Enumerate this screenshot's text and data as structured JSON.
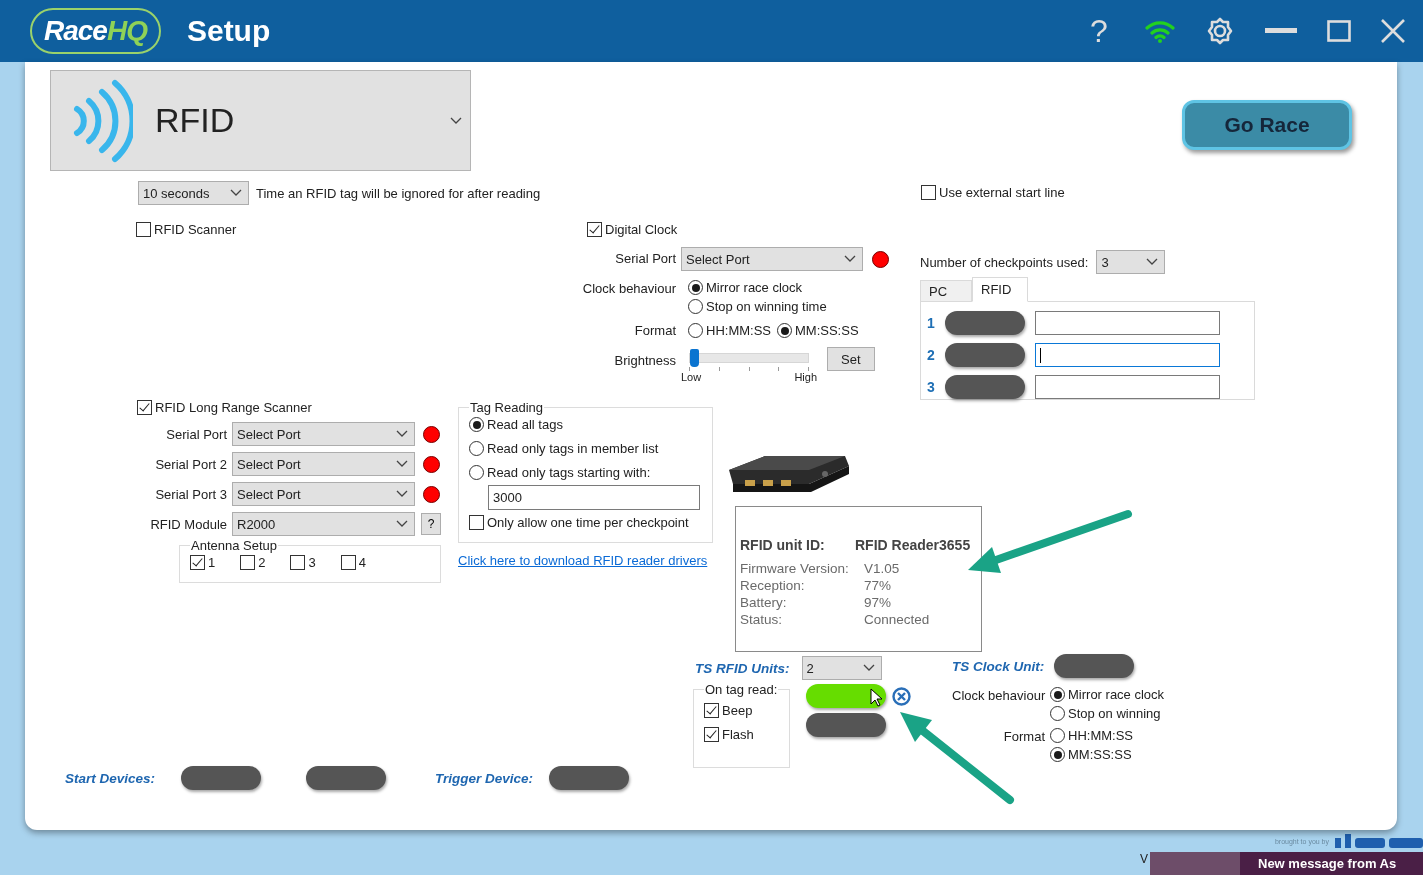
{
  "header": {
    "logo": [
      "Race",
      "HQ"
    ],
    "title": "Setup",
    "help": "?"
  },
  "module_select": {
    "value": "RFID"
  },
  "go_race": "Go Race",
  "ignore_time": {
    "value": "10 seconds",
    "label": "Time an RFID tag will be ignored for after reading"
  },
  "rfid_scanner": {
    "label": "RFID Scanner",
    "checked": false
  },
  "digital_clock": {
    "label": "Digital Clock",
    "checked": true,
    "serial_port": {
      "label": "Serial Port",
      "value": "Select Port",
      "color": "#ff0000"
    },
    "clock_behaviour": {
      "label": "Clock behaviour",
      "options": [
        {
          "label": "Mirror race clock",
          "selected": true
        },
        {
          "label": "Stop on winning time",
          "selected": false
        }
      ]
    },
    "format": {
      "label": "Format",
      "options": [
        {
          "label": "HH:MM:SS",
          "selected": false
        },
        {
          "label": "MM:SS:SS",
          "selected": true
        }
      ]
    },
    "brightness": {
      "label": "Brightness",
      "level": 0,
      "low": "Low",
      "high": "High",
      "button": "Set"
    }
  },
  "external_start": {
    "label": "Use external start line",
    "checked": false
  },
  "checkpoints": {
    "label": "Number of checkpoints used:",
    "value": "3",
    "tabs": [
      {
        "label": "PC",
        "selected": false
      },
      {
        "label": "RFID",
        "selected": true
      }
    ],
    "rows": [
      {
        "number": "1",
        "focused": false
      },
      {
        "number": "2",
        "focused": true
      },
      {
        "number": "3",
        "focused": false
      }
    ]
  },
  "long_range": {
    "label": "RFID Long Range Scanner",
    "checked": true,
    "ports": [
      {
        "label": "Serial Port",
        "value": "Select Port",
        "color": "#ff0000"
      },
      {
        "label": "Serial Port 2",
        "value": "Select Port",
        "color": "#ff0000"
      },
      {
        "label": "Serial Port 3",
        "value": "Select Port",
        "color": "#ff0000"
      }
    ],
    "module": {
      "label": "RFID Module",
      "value": "R2000",
      "help": "?"
    },
    "antenna": {
      "title": "Antenna Setup",
      "items": [
        {
          "label": "1",
          "checked": true
        },
        {
          "label": "2",
          "checked": false
        },
        {
          "label": "3",
          "checked": false
        },
        {
          "label": "4",
          "checked": false
        }
      ]
    }
  },
  "tag_reading": {
    "title": "Tag Reading",
    "options": [
      {
        "label": "Read all tags",
        "selected": true
      },
      {
        "label": "Read only tags in member list",
        "selected": false
      },
      {
        "label": "Read only tags starting with:",
        "selected": false
      }
    ],
    "prefix": "3000",
    "one_time": {
      "label": "Only allow one time per checkpoint",
      "checked": false
    },
    "link": "Click here to download RFID reader drivers"
  },
  "tooltip": {
    "rows": [
      {
        "kind": "heading",
        "label": "RFID unit ID:",
        "value": "RFID Reader3655"
      },
      {
        "kind": "detail",
        "label": "Firmware Version:",
        "value": "V1.05"
      },
      {
        "kind": "detail",
        "label": "Reception:",
        "value": "77%"
      },
      {
        "kind": "detail",
        "label": "Battery:",
        "value": "97%"
      },
      {
        "kind": "detail",
        "label": "Status:",
        "value": "Connected"
      }
    ]
  },
  "ts_rfid": {
    "label": "TS RFID Units:",
    "value": "2",
    "on_tag_read": {
      "title": "On tag read:",
      "options": [
        {
          "label": "Beep",
          "checked": true
        },
        {
          "label": "Flash",
          "checked": true
        }
      ]
    },
    "units": [
      {
        "selected": true
      },
      {
        "selected": false
      }
    ]
  },
  "ts_clock": {
    "label": "TS Clock Unit:",
    "clock_behaviour": {
      "label": "Clock behaviour",
      "options": [
        {
          "label": "Mirror race clock",
          "selected": true
        },
        {
          "label": "Stop on winning",
          "selected": false
        }
      ]
    },
    "format": {
      "label": "Format",
      "options": [
        {
          "label": "HH:MM:SS",
          "selected": false
        },
        {
          "label": "MM:SS:SS",
          "selected": true
        }
      ]
    }
  },
  "start_devices": {
    "label": "Start Devices:"
  },
  "trigger_device": {
    "label": "Trigger Device:"
  },
  "footer": {
    "version": "V",
    "credit": "brought to you by",
    "notification": "New message from As"
  }
}
